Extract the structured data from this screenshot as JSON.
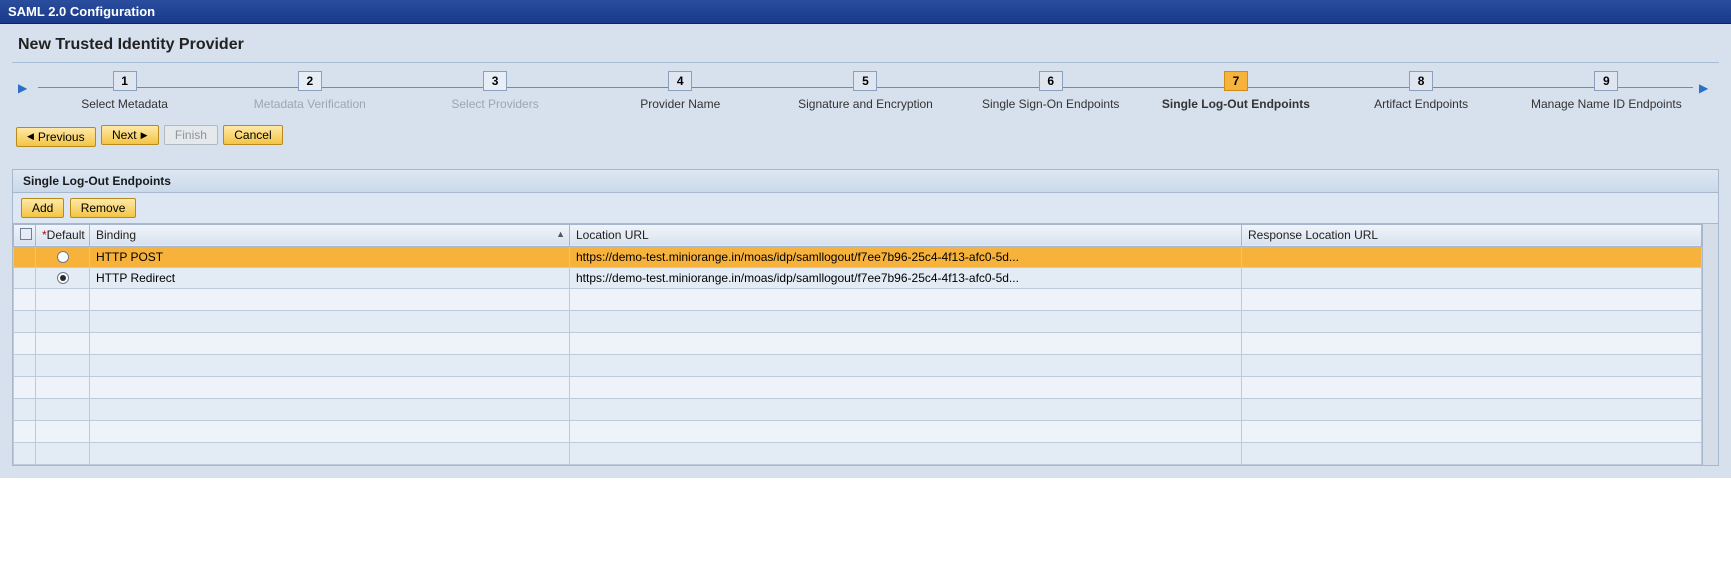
{
  "title": "SAML 2.0 Configuration",
  "section": "New Trusted Identity Provider",
  "wizard": {
    "steps": [
      {
        "num": "1",
        "label": "Select Metadata",
        "state": "done"
      },
      {
        "num": "2",
        "label": "Metadata Verification",
        "state": "disabled"
      },
      {
        "num": "3",
        "label": "Select Providers",
        "state": "disabled"
      },
      {
        "num": "4",
        "label": "Provider Name",
        "state": "done"
      },
      {
        "num": "5",
        "label": "Signature and Encryption",
        "state": "done"
      },
      {
        "num": "6",
        "label": "Single Sign-On Endpoints",
        "state": "done"
      },
      {
        "num": "7",
        "label": "Single Log-Out Endpoints",
        "state": "current"
      },
      {
        "num": "8",
        "label": "Artifact Endpoints",
        "state": "done"
      },
      {
        "num": "9",
        "label": "Manage Name ID Endpoints",
        "state": "done"
      }
    ]
  },
  "buttons": {
    "previous": "Previous",
    "next": "Next",
    "finish": "Finish",
    "cancel": "Cancel"
  },
  "panel": {
    "title": "Single Log-Out Endpoints",
    "add": "Add",
    "remove": "Remove",
    "columns": {
      "default": "Default",
      "binding": "Binding",
      "location": "Location URL",
      "response": "Response Location URL",
      "required_marker": "*"
    },
    "rows": [
      {
        "selected": true,
        "default": false,
        "binding": "HTTP POST",
        "location": "https://demo-test.miniorange.in/moas/idp/samllogout/f7ee7b96-25c4-4f13-afc0-5d...",
        "response": ""
      },
      {
        "selected": false,
        "default": true,
        "binding": "HTTP Redirect",
        "location": "https://demo-test.miniorange.in/moas/idp/samllogout/f7ee7b96-25c4-4f13-afc0-5d...",
        "response": ""
      }
    ],
    "empty_rows": 8
  }
}
